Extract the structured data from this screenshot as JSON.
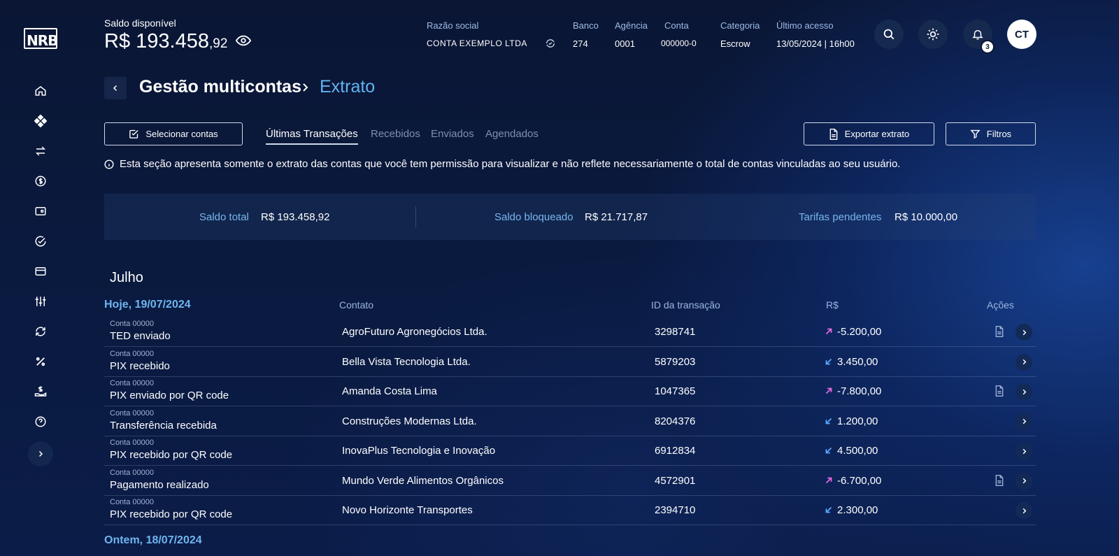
{
  "app": {
    "logo_text": "NRB"
  },
  "header": {
    "balance_label": "Saldo disponível",
    "balance_main": "R$ 193.458",
    "balance_cents": ",92",
    "razao_social_label": "Razão social",
    "razao_social_value": "CONTA EXEMPLO LTDA",
    "banco_label": "Banco",
    "banco_value": "274",
    "agencia_label": "Agência",
    "agencia_value": "0001",
    "conta_label": "Conta",
    "conta_value": "000000-0",
    "categoria_label": "Categoria",
    "categoria_value": "Escrow",
    "ultimo_acesso_label": "Último acesso",
    "ultimo_acesso_value": "13/05/2024 | 16h00",
    "notification_count": "3",
    "avatar_initials": "CT"
  },
  "page": {
    "title": "Gestão multicontas",
    "breadcrumb_current": "Extrato"
  },
  "controls": {
    "select_accounts_label": "Selecionar contas",
    "tabs": [
      "Últimas Transações",
      "Recebidos",
      "Enviados",
      "Agendados"
    ],
    "active_tab": "Últimas Transações",
    "export_label": "Exportar extrato",
    "filters_label": "Filtros"
  },
  "info_text": "Esta seção apresenta somente o extrato das contas que você tem permissão para visualizar e não reflete necessariamente o total de contas vinculadas ao seu usuário.",
  "summary": {
    "total_label": "Saldo total",
    "total_value": "R$ 193.458,92",
    "blocked_label": "Saldo bloqueado",
    "blocked_value": "R$ 21.717,87",
    "fees_label": "Tarifas pendentes",
    "fees_value": "R$ 10.000,00"
  },
  "statement": {
    "month": "Julho",
    "today_label": "Hoje, 19/07/2024",
    "yesterday_label": "Ontem, 18/07/2024",
    "columns": {
      "contact": "Contato",
      "transaction_id": "ID da transação",
      "amount": "R$",
      "actions": "Ações"
    },
    "rows": [
      {
        "account": "Conta 00000",
        "type": "TED enviado",
        "contact": "AgroFuturo Agronegócios Ltda.",
        "id": "3298741",
        "amount": "-5.200,00",
        "direction": "out",
        "has_doc": true
      },
      {
        "account": "Conta 00000",
        "type": "PIX recebido",
        "contact": "Bella Vista Tecnologia Ltda.",
        "id": "5879203",
        "amount": "3.450,00",
        "direction": "in",
        "has_doc": false
      },
      {
        "account": "Conta 00000",
        "type": "PIX enviado por QR code",
        "contact": "Amanda Costa Lima",
        "id": "1047365",
        "amount": "-7.800,00",
        "direction": "out",
        "has_doc": true
      },
      {
        "account": "Conta 00000",
        "type": "Transferência recebida",
        "contact": "Construções Modernas Ltda.",
        "id": "8204376",
        "amount": "1.200,00",
        "direction": "in",
        "has_doc": false
      },
      {
        "account": "Conta 00000",
        "type": "PIX recebido por QR code",
        "contact": "InovaPlus Tecnologia e Inovação",
        "id": "6912834",
        "amount": "4.500,00",
        "direction": "in",
        "has_doc": false
      },
      {
        "account": "Conta 00000",
        "type": "Pagamento realizado",
        "contact": "Mundo Verde Alimentos Orgânicos",
        "id": "4572901",
        "amount": "-6.700,00",
        "direction": "out",
        "has_doc": true
      },
      {
        "account": "Conta 00000",
        "type": "PIX recebido por QR code",
        "contact": "Novo Horizonte Transportes",
        "id": "2394710",
        "amount": "2.300,00",
        "direction": "in",
        "has_doc": false
      }
    ]
  },
  "colors": {
    "accent": "#62b4f2",
    "out_arrow": "#e46be0",
    "in_arrow": "#58a8ff"
  },
  "sidebar_icons": [
    "home-icon",
    "grid-icon",
    "transfer-icon",
    "dollar-icon",
    "wallet-icon",
    "check-circle-icon",
    "card-icon",
    "sliders-icon",
    "sync-icon",
    "percent-icon",
    "money-hand-icon",
    "help-icon"
  ]
}
